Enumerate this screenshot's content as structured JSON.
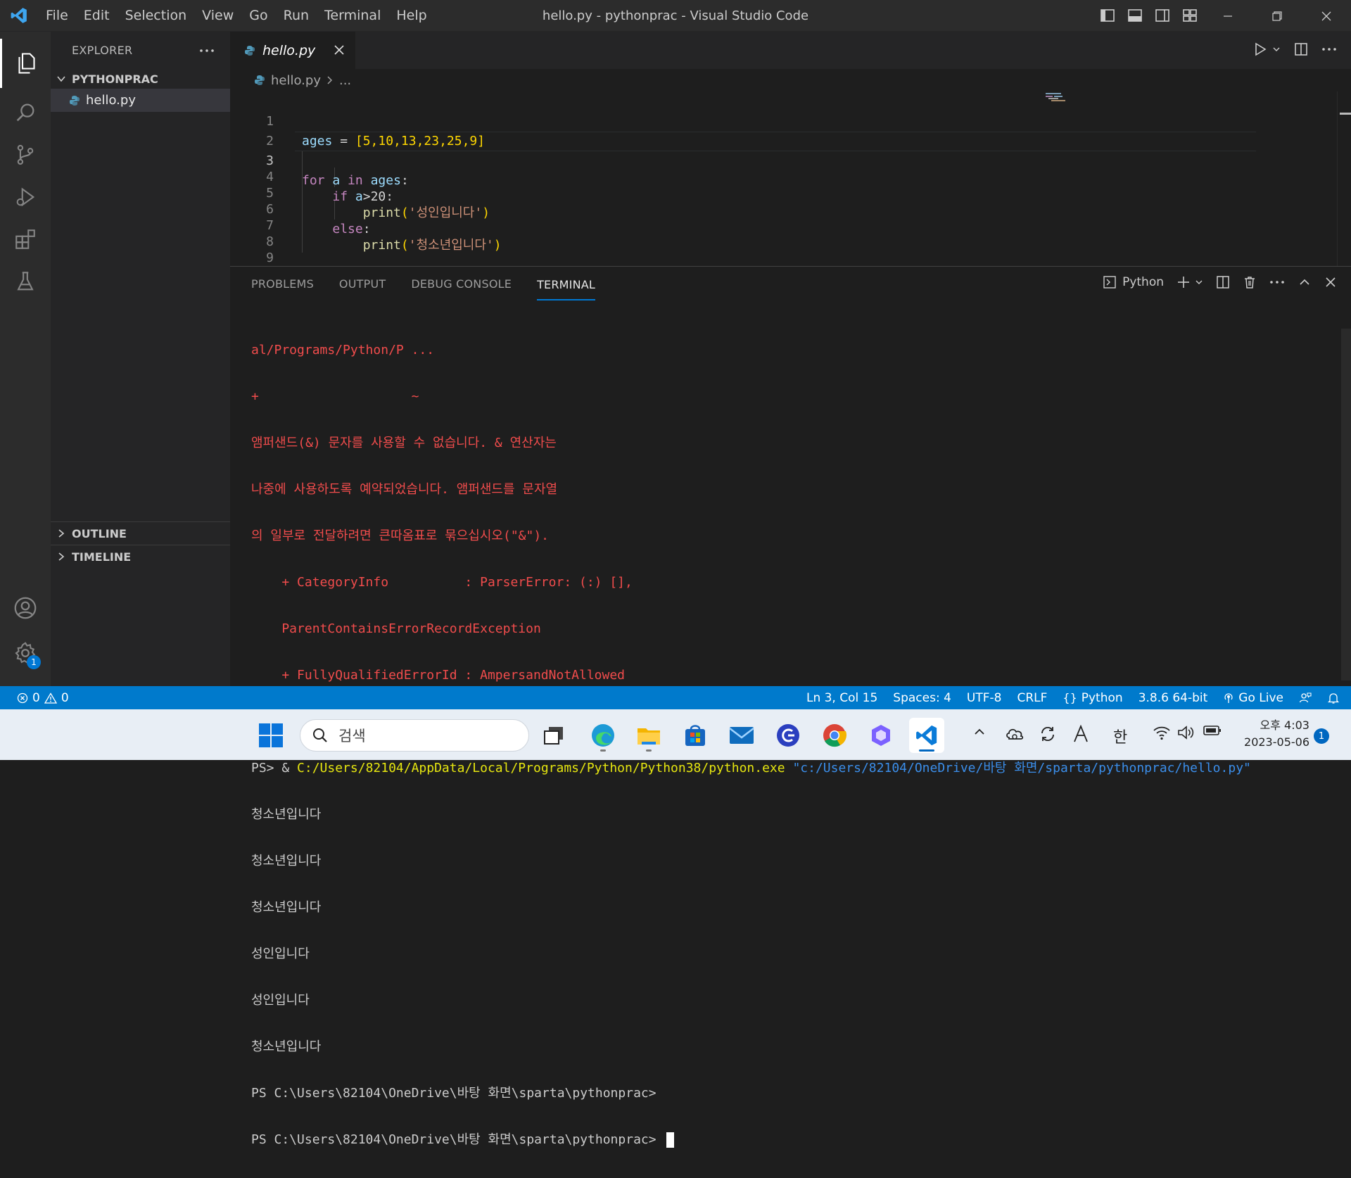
{
  "window": {
    "title": "hello.py - pythonprac - Visual Studio Code",
    "menu": [
      "File",
      "Edit",
      "Selection",
      "View",
      "Go",
      "Run",
      "Terminal",
      "Help"
    ]
  },
  "sidebar": {
    "header": "EXPLORER",
    "folder": "PYTHONPRAC",
    "file": "hello.py",
    "outline": "OUTLINE",
    "timeline": "TIMELINE"
  },
  "activity": {
    "settings_badge": "1"
  },
  "editor": {
    "tab": "hello.py",
    "breadcrumb": {
      "file": "hello.py",
      "more": "..."
    },
    "line_numbers": [
      "1",
      "2",
      "3",
      "4",
      "5",
      "6",
      "7",
      "8",
      "9"
    ],
    "code": {
      "l1_var": "ages",
      "l1_eq": " = ",
      "l1_val": "[5,10,13,23,25,9]",
      "l3_for": "for",
      "l3_a": "a",
      "l3_in": "in",
      "l3_ages": "ages",
      "l3_colon": ":",
      "l4_if": "if",
      "l4_cond": "a",
      "l4_rest": ">20:",
      "l5_print": "print",
      "l5_str": "'성인입니다'",
      "l6_else": "else",
      "l6_colon": ":",
      "l7_print": "print",
      "l7_str": "'청소년입니다'"
    }
  },
  "panel": {
    "tabs": [
      "PROBLEMS",
      "OUTPUT",
      "DEBUG CONSOLE",
      "TERMINAL"
    ],
    "active_tab": "TERMINAL",
    "shell": "Python",
    "terminal": {
      "err_lines": [
        "al/Programs/Python/P ...",
        "+                    ~",
        "앰퍼샌드(&) 문자를 사용할 수 없습니다. & 연산자는",
        "나중에 사용하도록 예약되었습니다. 앰퍼샌드를 문자열",
        "의 일부로 전달하려면 큰따옴표로 묶으십시오(\"&\").",
        "    + CategoryInfo          : ParserError: (:) [],",
        "    ParentContainsErrorRecordException",
        "    + FullyQualifiedErrorId : AmpersandNotAllowed"
      ],
      "cmd_prefix": "PS> & ",
      "cmd_exe": "C:/Users/82104/AppData/Local/Programs/Python/Python38/python.exe",
      "cmd_arg": "\"c:/Users/82104/OneDrive/바탕 화면/sparta/pythonprac/hello.py\"",
      "outputs": [
        "청소년입니다",
        "청소년입니다",
        "청소년입니다",
        "성인입니다",
        "성인입니다",
        "청소년입니다"
      ],
      "prompts": [
        "PS C:\\Users\\82104\\OneDrive\\바탕 화면\\sparta\\pythonprac>",
        "PS C:\\Users\\82104\\OneDrive\\바탕 화면\\sparta\\pythonprac>"
      ]
    }
  },
  "statusbar": {
    "errors": "0",
    "warnings": "0",
    "position": "Ln 3, Col 15",
    "spaces": "Spaces: 4",
    "encoding": "UTF-8",
    "eol": "CRLF",
    "language": "Python",
    "interpreter": "3.8.6 64-bit",
    "golive": "Go Live"
  },
  "taskbar": {
    "search_placeholder": "검색",
    "ime": "한",
    "time": "오후 4:03",
    "date": "2023-05-06",
    "notifications": "1"
  },
  "colors": {
    "accent": "#007acc",
    "titlebar": "#2c2c2c",
    "editor_bg": "#1e1e1e",
    "terminal_error": "#f14c4c",
    "terminal_path": "#e5e510",
    "terminal_arg": "#3b8eea"
  }
}
